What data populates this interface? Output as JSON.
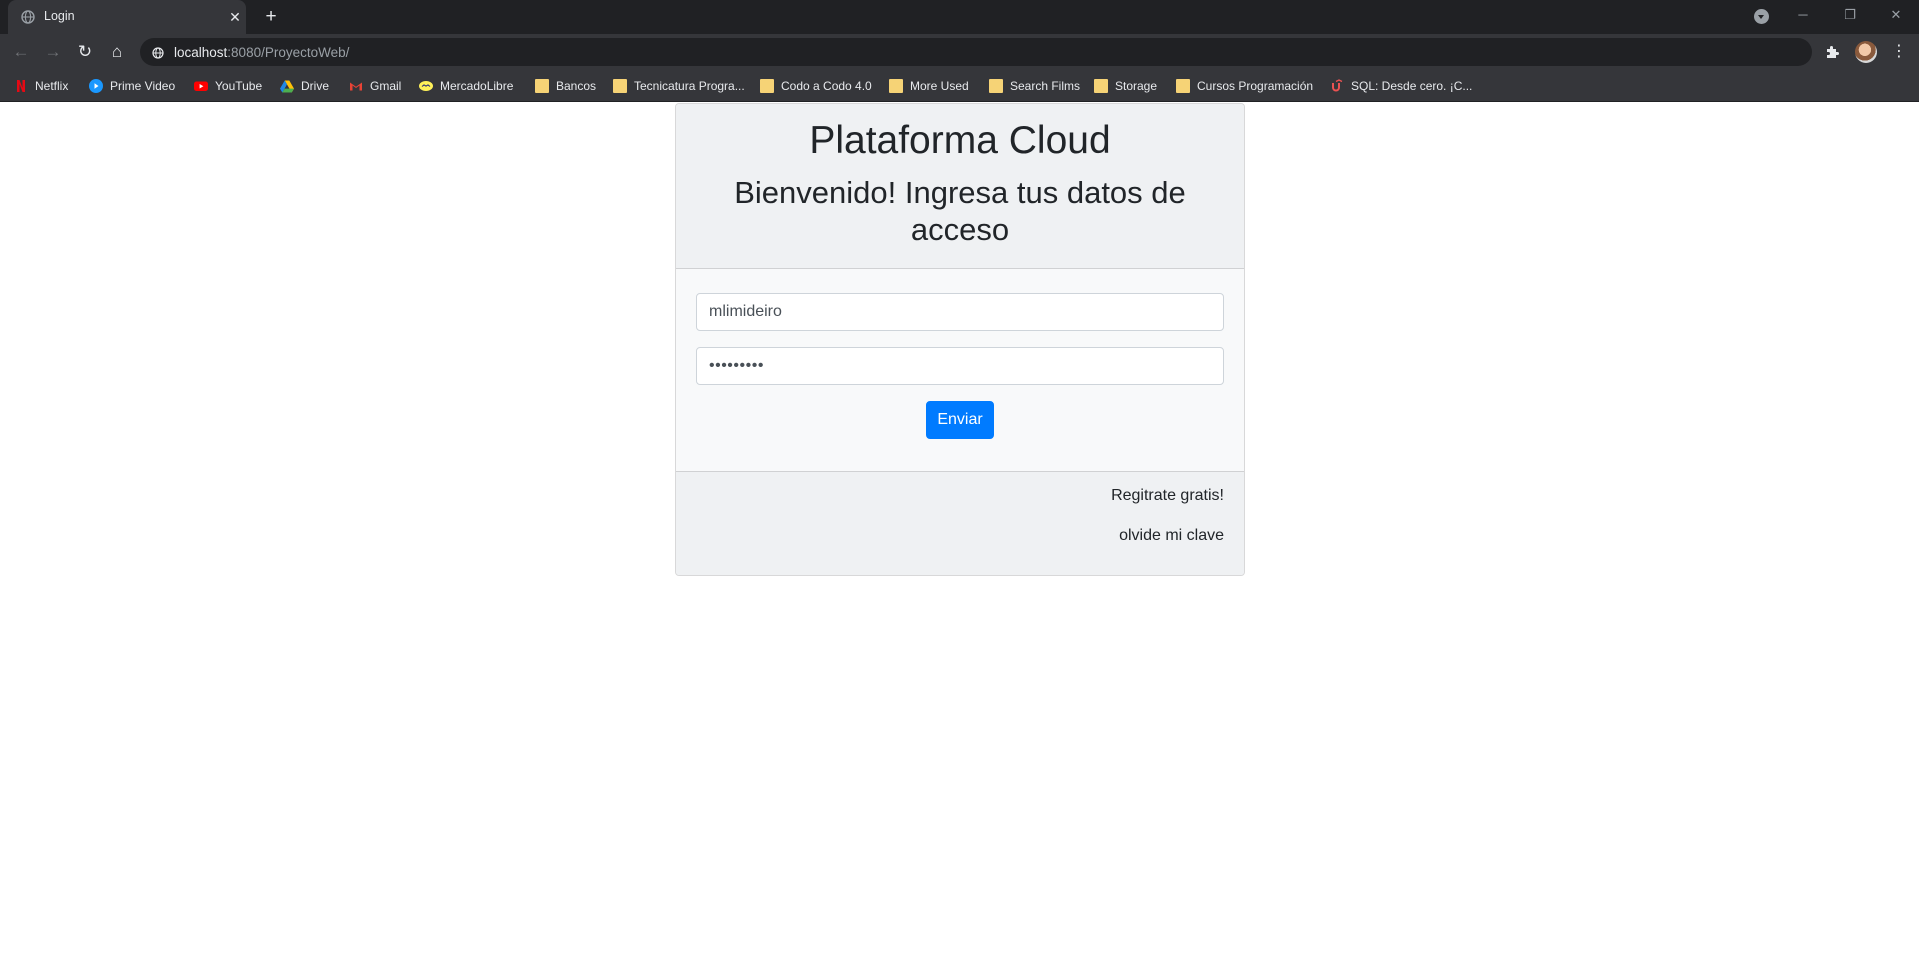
{
  "browser": {
    "tab_title": "Login",
    "tab_close": "✕",
    "new_tab": "+",
    "url_host": "localhost",
    "url_path": ":8080/ProyectoWeb/",
    "window_controls": {
      "minimize": "─",
      "restore": "❐",
      "close": "✕"
    },
    "nav": {
      "back": "←",
      "forward": "→",
      "reload": "↻",
      "home": "⌂"
    },
    "menu": "⋮",
    "bookmarks": [
      {
        "label": "Netflix",
        "icon": "netflix-icon"
      },
      {
        "label": "Prime Video",
        "icon": "prime-video-icon"
      },
      {
        "label": "YouTube",
        "icon": "youtube-icon"
      },
      {
        "label": "Drive",
        "icon": "drive-icon"
      },
      {
        "label": "Gmail",
        "icon": "gmail-icon"
      },
      {
        "label": "MercadoLibre",
        "icon": "mercadolibre-icon"
      },
      {
        "label": "Bancos",
        "icon": "folder-icon"
      },
      {
        "label": "Tecnicatura Progra...",
        "icon": "folder-icon"
      },
      {
        "label": "Codo a Codo 4.0",
        "icon": "folder-icon"
      },
      {
        "label": "More Used",
        "icon": "folder-icon"
      },
      {
        "label": "Search Films",
        "icon": "folder-icon"
      },
      {
        "label": "Storage",
        "icon": "folder-icon"
      },
      {
        "label": "Cursos Programación",
        "icon": "folder-icon"
      },
      {
        "label": "SQL: Desde cero. ¡C...",
        "icon": "udemy-icon"
      }
    ]
  },
  "login": {
    "title": "Plataforma Cloud",
    "subtitle_line1": "Bienvenido! Ingresa tus datos de",
    "subtitle_line2": "acceso",
    "username_value": "mlimideiro",
    "password_value": "•••••••••",
    "submit_label": "Enviar",
    "register_link": "Regitrate gratis!",
    "forgot_link": "olvide mi clave"
  },
  "colors": {
    "primary": "#007bff",
    "chrome_dark": "#202124",
    "chrome_toolbar": "#35363a",
    "card_header": "#eff1f3"
  }
}
